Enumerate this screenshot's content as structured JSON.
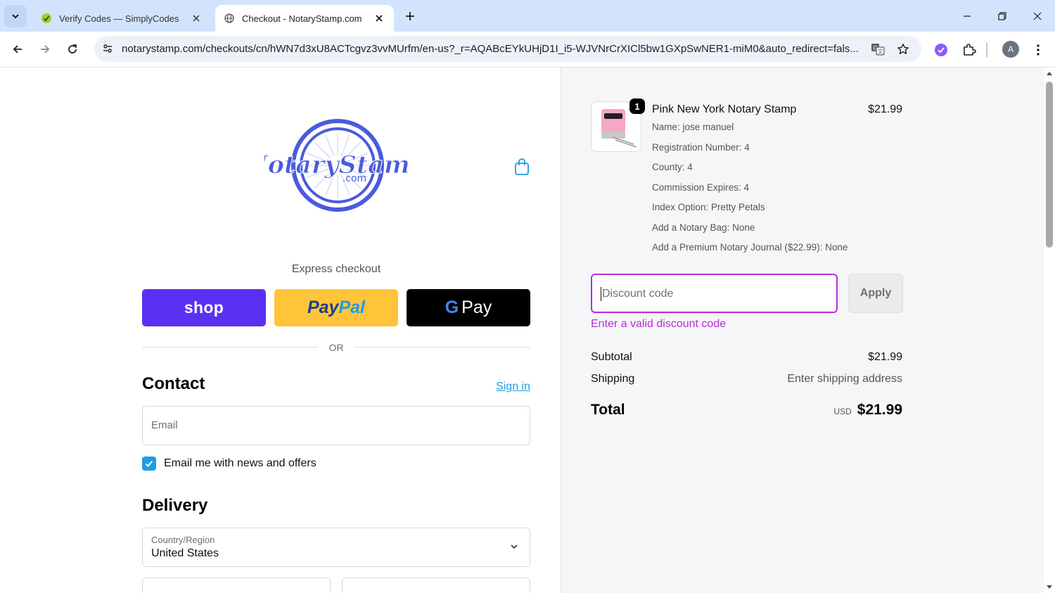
{
  "browser": {
    "tabs": [
      {
        "title": "Verify Codes — SimplyCodes",
        "icon": "simplycodes-favicon"
      },
      {
        "title": "Checkout - NotaryStamp.com",
        "icon": "globe-favicon",
        "active": true
      }
    ],
    "url": "notarystamp.com/checkouts/cn/hWN7d3xU8ACTcgvz3vvMUrfm/en-us?_r=AQABcEYkUHjD1I_i5-WJVNrCrXICl5bw1GXpSwNER1-miM0&auto_redirect=fals...",
    "profile_initial": "A"
  },
  "checkout": {
    "logo_text": "NotaryStamp",
    "logo_sub": ".com",
    "express_label": "Express checkout",
    "pay_buttons": {
      "shop": "shop",
      "paypal_a": "Pay",
      "paypal_b": "Pal",
      "gpay_g": "G",
      "gpay": "Pay"
    },
    "or_label": "OR",
    "contact_heading": "Contact",
    "signin_label": "Sign in",
    "email_placeholder": "Email",
    "newsletter_label": "Email me with news and offers",
    "newsletter_checked": true,
    "delivery_heading": "Delivery",
    "country_label": "Country/Region",
    "country_value": "United States"
  },
  "order": {
    "quantity": "1",
    "title": "Pink New York Notary Stamp",
    "price": "$21.99",
    "properties": [
      "Name: jose manuel",
      "Registration Number: 4",
      "County: 4",
      "Commission Expires: 4",
      "Index Option: Pretty Petals",
      "Add a Notary Bag: None",
      "Add a Premium Notary Journal ($22.99): None"
    ],
    "discount_placeholder": "Discount code",
    "apply_label": "Apply",
    "discount_error": "Enter a valid discount code",
    "subtotal_label": "Subtotal",
    "subtotal_value": "$21.99",
    "shipping_label": "Shipping",
    "shipping_value": "Enter shipping address",
    "total_label": "Total",
    "total_currency": "USD",
    "total_value": "$21.99"
  },
  "colors": {
    "shop_pay": "#5a31f4",
    "paypal": "#ffc43a",
    "link": "#1d9de2",
    "discount_error": "#b52fd6",
    "logo_blue": "#4a5bdc"
  }
}
